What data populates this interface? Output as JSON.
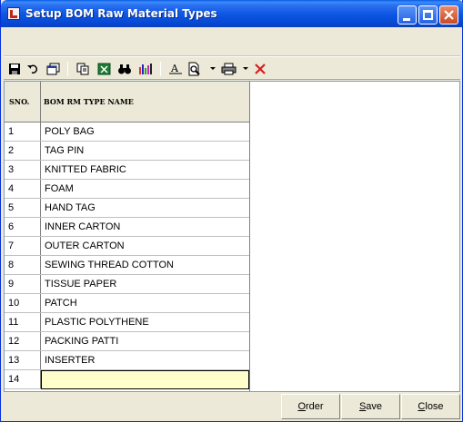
{
  "window": {
    "title": "Setup BOM Raw Material Types"
  },
  "toolbar": {
    "icons": [
      "save-icon",
      "undo-icon",
      "window-icon",
      "copy-icon",
      "excel-icon",
      "find-icon",
      "chart-icon",
      "font-icon",
      "preview-icon",
      "print-icon",
      "delete-icon"
    ]
  },
  "grid": {
    "headers": [
      "SNO.",
      "BOM RM TYPE NAME"
    ],
    "rows": [
      {
        "sno": "1",
        "name": "POLY BAG"
      },
      {
        "sno": "2",
        "name": "TAG PIN"
      },
      {
        "sno": "3",
        "name": "KNITTED FABRIC"
      },
      {
        "sno": "4",
        "name": "FOAM"
      },
      {
        "sno": "5",
        "name": "HAND TAG"
      },
      {
        "sno": "6",
        "name": "INNER CARTON"
      },
      {
        "sno": "7",
        "name": "OUTER CARTON"
      },
      {
        "sno": "8",
        "name": "SEWING THREAD COTTON"
      },
      {
        "sno": "9",
        "name": "TISSUE PAPER"
      },
      {
        "sno": "10",
        "name": "PATCH"
      },
      {
        "sno": "11",
        "name": "PLASTIC POLYTHENE"
      },
      {
        "sno": "12",
        "name": "PACKING PATTI"
      },
      {
        "sno": "13",
        "name": "INSERTER"
      },
      {
        "sno": "14",
        "name": ""
      }
    ]
  },
  "buttons": {
    "order": {
      "first": "O",
      "rest": "rder"
    },
    "save": {
      "first": "S",
      "rest": "ave"
    },
    "close": {
      "first": "C",
      "rest": "lose"
    }
  },
  "colors": {
    "titlebar": "#0b55e2",
    "active_cell": "#ffffcc",
    "delete": "#d81e1e"
  }
}
